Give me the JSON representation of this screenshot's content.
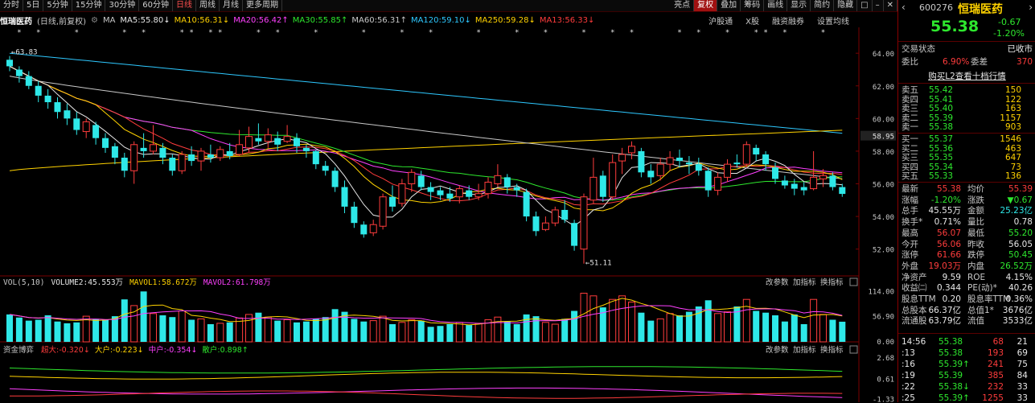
{
  "toolbar": {
    "tabs": [
      "分时",
      "5日",
      "5分钟",
      "15分钟",
      "30分钟",
      "60分钟",
      "日线",
      "周线",
      "月线",
      "更多周期"
    ],
    "active_tab": 6,
    "right_buttons": [
      "亮点",
      "复权",
      "叠加",
      "筹码",
      "画线",
      "显示",
      "简约",
      "隐藏"
    ],
    "icons": [
      "window-icon",
      "minus-icon",
      "close-icon"
    ]
  },
  "info": {
    "stock_name": "恒瑞医药",
    "adjust": "(日线,前复权)",
    "ma_label": "MA",
    "mas": [
      {
        "name": "MA5",
        "value": "55.80",
        "arrow": "down",
        "color": "#e8e8e8"
      },
      {
        "name": "MA10",
        "value": "56.31",
        "arrow": "down",
        "color": "#ffd200"
      },
      {
        "name": "MA20",
        "value": "56.42",
        "arrow": "up",
        "color": "#ff40ff"
      },
      {
        "name": "MA30",
        "value": "55.85",
        "arrow": "up",
        "color": "#2ee82e"
      },
      {
        "name": "MA60",
        "value": "56.31",
        "arrow": "up",
        "color": "#c8c8c8"
      },
      {
        "name": "MA120",
        "value": "59.10",
        "arrow": "down",
        "color": "#2ec8ff"
      },
      {
        "name": "MA250",
        "value": "59.28",
        "arrow": "down",
        "color": "#ffd200"
      },
      {
        "name": "MA13",
        "value": "56.33",
        "arrow": "down",
        "color": "#ff3c3c"
      }
    ],
    "links": [
      "沪股通",
      "X股",
      "融资融券",
      "设置均线"
    ]
  },
  "price_axis": [
    "64.00",
    "62.00",
    "60.00",
    "58.00",
    "56.00",
    "54.00",
    "52.00"
  ],
  "current_price_tag": "58.95",
  "high_marker": "63.83",
  "low_marker": "51.11",
  "vol_panel": {
    "title": "VOL(5,10)",
    "volume": "VOLUME2:45.553万",
    "mavol1": "MAVOL1:58.672万",
    "mavol2": "MAVOL2:61.798万",
    "axis": [
      "114.00",
      "56.90",
      "0.00"
    ],
    "buttons": [
      "改参数",
      "加指标",
      "换指标"
    ]
  },
  "fund_panel": {
    "title": "资金博弈",
    "items": [
      {
        "label": "超大:-0.320",
        "color": "#ff3c3c",
        "arrow": "down"
      },
      {
        "label": "大户:-0.223",
        "color": "#ffd200",
        "arrow": "down"
      },
      {
        "label": "中户:-0.354",
        "color": "#ff40ff",
        "arrow": "down"
      },
      {
        "label": "散户:0.898",
        "color": "#2ee82e",
        "arrow": "up"
      }
    ],
    "axis": [
      "2.68",
      "0.61",
      "-1.33"
    ],
    "buttons": [
      "改参数",
      "加指标",
      "换指标"
    ]
  },
  "chart_data": {
    "type": "candlestick",
    "candles": [
      [
        63.6,
        63.2,
        63.83,
        62.9
      ],
      [
        63.0,
        62.6,
        63.2,
        62.2
      ],
      [
        62.6,
        62.0,
        62.9,
        61.8
      ],
      [
        62.0,
        61.4,
        62.3,
        61.0
      ],
      [
        61.4,
        61.0,
        61.8,
        60.6
      ],
      [
        61.0,
        60.4,
        61.3,
        60.0
      ],
      [
        60.5,
        60.0,
        60.9,
        59.6
      ],
      [
        60.0,
        59.3,
        60.4,
        59.0
      ],
      [
        59.2,
        59.8,
        60.0,
        58.8
      ],
      [
        59.6,
        58.8,
        59.8,
        58.4
      ],
      [
        58.8,
        58.2,
        59.1,
        57.9
      ],
      [
        58.3,
        57.6,
        58.5,
        57.2
      ],
      [
        57.6,
        56.8,
        57.9,
        56.4
      ],
      [
        56.8,
        58.4,
        58.6,
        56.0
      ],
      [
        58.2,
        58.0,
        59.1,
        57.6
      ],
      [
        58.0,
        58.4,
        59.6,
        57.8
      ],
      [
        58.2,
        57.6,
        58.5,
        57.2
      ],
      [
        57.6,
        56.8,
        57.8,
        56.5
      ],
      [
        56.8,
        57.8,
        58.0,
        56.6
      ],
      [
        57.8,
        57.4,
        58.3,
        57.1
      ],
      [
        57.4,
        58.0,
        58.2,
        56.8
      ],
      [
        57.8,
        57.6,
        58.4,
        57.3
      ],
      [
        57.6,
        58.1,
        58.3,
        57.4
      ],
      [
        58.0,
        57.7,
        58.5,
        57.5
      ],
      [
        57.8,
        58.4,
        59.3,
        57.7
      ],
      [
        58.2,
        58.9,
        59.5,
        57.9
      ],
      [
        58.8,
        58.6,
        59.7,
        58.4
      ],
      [
        58.6,
        59.0,
        59.4,
        58.2
      ],
      [
        58.8,
        58.4,
        59.2,
        58.0
      ],
      [
        58.6,
        58.9,
        59.6,
        58.5
      ],
      [
        58.8,
        58.3,
        59.1,
        57.9
      ],
      [
        58.2,
        58.0,
        58.4,
        57.6
      ],
      [
        58.0,
        57.2,
        58.1,
        56.9
      ],
      [
        57.1,
        56.8,
        57.4,
        56.5
      ],
      [
        56.8,
        55.8,
        57.0,
        55.5
      ],
      [
        55.8,
        54.6,
        56.2,
        54.2
      ],
      [
        54.6,
        53.6,
        54.9,
        53.3
      ],
      [
        53.5,
        52.9,
        53.7,
        52.7
      ],
      [
        53.0,
        53.5,
        53.8,
        52.8
      ],
      [
        53.4,
        55.2,
        55.4,
        53.2
      ],
      [
        55.2,
        54.6,
        55.9,
        54.3
      ],
      [
        54.8,
        56.0,
        56.3,
        54.6
      ],
      [
        56.0,
        56.7,
        56.9,
        55.5
      ],
      [
        56.5,
        55.8,
        56.8,
        55.6
      ],
      [
        55.8,
        55.5,
        56.1,
        55.0
      ],
      [
        55.6,
        55.3,
        55.8,
        55.0
      ],
      [
        55.4,
        55.1,
        55.8,
        54.9
      ],
      [
        55.2,
        55.7,
        55.9,
        54.8
      ],
      [
        55.6,
        55.2,
        55.9,
        55.0
      ],
      [
        55.2,
        55.4,
        56.0,
        55.0
      ],
      [
        55.4,
        56.1,
        56.4,
        55.1
      ],
      [
        56.0,
        56.5,
        57.2,
        55.8
      ],
      [
        56.4,
        55.8,
        56.6,
        55.4
      ],
      [
        55.8,
        55.6,
        56.0,
        55.2
      ],
      [
        55.5,
        54.0,
        55.7,
        53.7
      ],
      [
        54.0,
        53.1,
        54.3,
        52.8
      ],
      [
        53.2,
        53.6,
        54.0,
        53.1
      ],
      [
        53.6,
        54.4,
        54.6,
        53.4
      ],
      [
        54.4,
        53.8,
        55.0,
        53.6
      ],
      [
        53.6,
        52.2,
        53.8,
        51.9
      ],
      [
        52.0,
        55.2,
        55.4,
        51.11
      ],
      [
        55.0,
        56.4,
        57.6,
        54.8
      ],
      [
        56.5,
        55.2,
        56.8,
        54.9
      ],
      [
        55.2,
        57.3,
        57.8,
        55.0
      ],
      [
        57.4,
        57.8,
        58.2,
        56.6
      ],
      [
        57.9,
        58.3,
        58.6,
        57.5
      ],
      [
        58.0,
        56.7,
        58.2,
        56.4
      ],
      [
        56.8,
        56.4,
        57.2,
        56.0
      ],
      [
        56.5,
        57.2,
        57.6,
        56.2
      ],
      [
        57.2,
        57.6,
        58.0,
        56.8
      ],
      [
        57.6,
        57.4,
        58.1,
        57.0
      ],
      [
        57.3,
        57.2,
        57.7,
        56.6
      ],
      [
        57.2,
        56.8,
        57.6,
        56.5
      ],
      [
        56.8,
        55.6,
        57.0,
        55.2
      ],
      [
        55.6,
        56.4,
        56.7,
        55.3
      ],
      [
        56.4,
        57.2,
        57.5,
        56.1
      ],
      [
        57.3,
        57.2,
        57.8,
        57.0
      ],
      [
        57.2,
        58.4,
        58.6,
        57.0
      ],
      [
        58.2,
        57.8,
        58.4,
        57.4
      ],
      [
        57.8,
        57.2,
        58.0,
        56.8
      ],
      [
        57.0,
        56.3,
        57.3,
        56.0
      ],
      [
        56.2,
        55.9,
        56.5,
        55.7
      ],
      [
        56.0,
        55.7,
        56.3,
        55.3
      ],
      [
        55.8,
        55.6,
        56.1,
        55.3
      ],
      [
        55.7,
        56.4,
        58.0,
        55.6
      ],
      [
        56.3,
        56.5,
        56.9,
        55.8
      ],
      [
        56.5,
        55.8,
        56.7,
        55.6
      ],
      [
        55.8,
        55.38,
        56.0,
        55.2
      ]
    ],
    "volumes": [
      62,
      55,
      48,
      50,
      60,
      46,
      42,
      44,
      58,
      52,
      50,
      58,
      96,
      82,
      114,
      64,
      60,
      56,
      70,
      50,
      52,
      40,
      42,
      44,
      54,
      62,
      66,
      56,
      48,
      50,
      44,
      46,
      52,
      56,
      74,
      68,
      52,
      46,
      48,
      58,
      40,
      44,
      50,
      48,
      34,
      36,
      40,
      44,
      38,
      42,
      50,
      56,
      46,
      40,
      62,
      58,
      44,
      40,
      52,
      70,
      110,
      104,
      78,
      96,
      104,
      90,
      66,
      48,
      52,
      64,
      60,
      68,
      80,
      94,
      64,
      68,
      80,
      96,
      70,
      66,
      60,
      46,
      62,
      40,
      96,
      62,
      50,
      45.553
    ]
  },
  "right_panel": {
    "code": "600276",
    "name": "恒瑞医药",
    "price": "55.38",
    "change": "-0.67",
    "change_pct": "-1.20%",
    "status_label": "交易状态",
    "status": "已收市",
    "weibi_label": "委比",
    "weibi": "6.90%",
    "weicha_label": "委差",
    "weicha": "370",
    "l2_button": "购买L2查看十档行情",
    "asks": [
      [
        "卖五",
        "55.42",
        "150"
      ],
      [
        "卖四",
        "55.41",
        "122"
      ],
      [
        "卖三",
        "55.40",
        "163"
      ],
      [
        "卖二",
        "55.39",
        "1157"
      ],
      [
        "卖一",
        "55.38",
        "903"
      ]
    ],
    "bids": [
      [
        "买一",
        "55.37",
        "1546"
      ],
      [
        "买二",
        "55.36",
        "463"
      ],
      [
        "买三",
        "55.35",
        "647"
      ],
      [
        "买四",
        "55.34",
        "73"
      ],
      [
        "买五",
        "55.33",
        "136"
      ]
    ],
    "stats": [
      [
        "最新",
        "55.38",
        "red",
        "均价",
        "55.39",
        "red"
      ],
      [
        "涨幅",
        "-1.20%",
        "green",
        "涨跌",
        "▼0.67",
        "green"
      ],
      [
        "总手",
        "45.55万",
        "white",
        "金额",
        "25.23亿",
        "cyan"
      ],
      [
        "换手*",
        "0.71%",
        "white",
        "量比",
        "0.78",
        "white"
      ],
      [
        "最高",
        "56.07",
        "red",
        "最低",
        "55.20",
        "green"
      ],
      [
        "今开",
        "56.06",
        "red",
        "昨收",
        "56.05",
        "white"
      ],
      [
        "涨停",
        "61.66",
        "red",
        "跌停",
        "50.45",
        "green"
      ],
      [
        "外盘",
        "19.03万",
        "red",
        "内盘",
        "26.52万",
        "green"
      ],
      [
        "净资产",
        "9.59",
        "white",
        "ROE",
        "4.15%",
        "white"
      ],
      [
        "收益㈡",
        "0.344",
        "white",
        "PE(动)*",
        "40.26",
        "white"
      ],
      [
        "股息TTM",
        "0.20",
        "white",
        "股息率TTM",
        "0.36%",
        "white"
      ],
      [
        "总股本",
        "66.37亿",
        "white",
        "总值1*",
        "3676亿",
        "white"
      ],
      [
        "流通股",
        "63.79亿",
        "white",
        "流值",
        "3533亿",
        "white"
      ]
    ],
    "ticks": [
      [
        "14:56",
        "55.38",
        "",
        "68",
        "21"
      ],
      [
        ":13",
        "55.38",
        "",
        "193",
        "69"
      ],
      [
        ":16",
        "55.39",
        "up",
        "241",
        "75"
      ],
      [
        ":19",
        "55.39",
        "",
        "385",
        "84"
      ],
      [
        ":22",
        "55.38",
        "down",
        "232",
        "33"
      ],
      [
        ":25",
        "55.39",
        "up",
        "1255",
        "33"
      ]
    ]
  }
}
